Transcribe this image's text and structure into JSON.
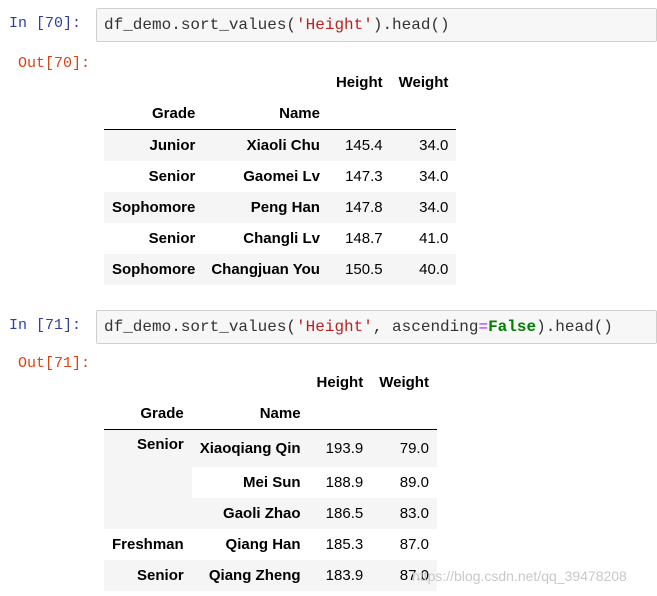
{
  "cells": [
    {
      "in_label": "In  [70]:",
      "out_label": "Out[70]:",
      "code": {
        "obj": "df_demo.",
        "method": "sort_values(",
        "arg_str": "'Height'",
        "rest": ").head()"
      },
      "table": {
        "columns": [
          "Height",
          "Weight"
        ],
        "index_names": [
          "Grade",
          "Name"
        ],
        "rows": [
          {
            "grade": "Junior",
            "name": "Xiaoli Chu",
            "height": "145.4",
            "weight": "34.0"
          },
          {
            "grade": "Senior",
            "name": "Gaomei Lv",
            "height": "147.3",
            "weight": "34.0"
          },
          {
            "grade": "Sophomore",
            "name": "Peng Han",
            "height": "147.8",
            "weight": "34.0"
          },
          {
            "grade": "Senior",
            "name": "Changli Lv",
            "height": "148.7",
            "weight": "41.0"
          },
          {
            "grade": "Sophomore",
            "name": "Changjuan You",
            "height": "150.5",
            "weight": "40.0"
          }
        ]
      }
    },
    {
      "in_label": "In  [71]:",
      "out_label": "Out[71]:",
      "code": {
        "obj": "df_demo.",
        "method": "sort_values(",
        "arg_str": "'Height'",
        "sep": ", ",
        "kwarg": "ascending",
        "eq": "=",
        "val": "False",
        "rest": ").head()"
      },
      "table": {
        "columns": [
          "Height",
          "Weight"
        ],
        "index_names": [
          "Grade",
          "Name"
        ],
        "rows": [
          {
            "grade": "Senior",
            "name": "Xiaoqiang Qin",
            "height": "193.9",
            "weight": "79.0"
          },
          {
            "grade": "",
            "name": "Mei Sun",
            "height": "188.9",
            "weight": "89.0"
          },
          {
            "grade": "",
            "name": "Gaoli Zhao",
            "height": "186.5",
            "weight": "83.0"
          },
          {
            "grade": "Freshman",
            "name": "Qiang Han",
            "height": "185.3",
            "weight": "87.0"
          },
          {
            "grade": "Senior",
            "name": "Qiang Zheng",
            "height": "183.9",
            "weight": "87.0"
          }
        ]
      }
    }
  ],
  "watermark": "https://blog.csdn.net/qq_39478208"
}
